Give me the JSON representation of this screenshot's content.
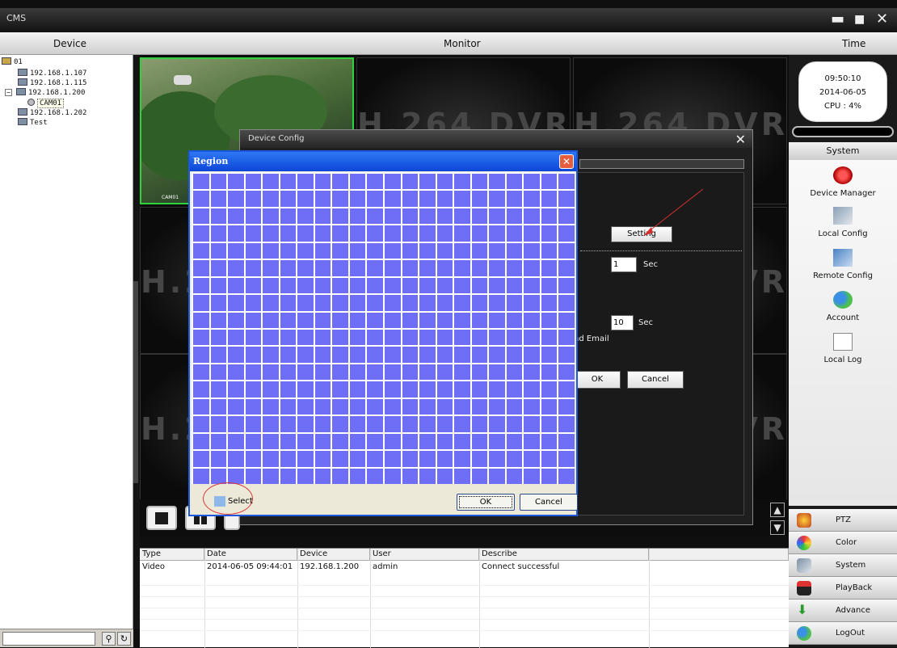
{
  "app": {
    "title": "CMS"
  },
  "header": {
    "device": "Device",
    "monitor": "Monitor",
    "time": "Time"
  },
  "tree": {
    "items": [
      "01",
      "192.168.1.107",
      "192.168.1.115",
      "192.168.1.200",
      "CAM01",
      "192.168.1.202",
      "Test"
    ]
  },
  "status": {
    "time": "09:50:10",
    "date": "2014-06-05",
    "cpu": "CPU : 4%"
  },
  "system_menu": {
    "header": "System",
    "items": [
      "Device Manager",
      "Local Config",
      "Remote Config",
      "Account",
      "Local Log"
    ]
  },
  "bottom_menu": [
    "PTZ",
    "Color",
    "System",
    "PlayBack",
    "Advance",
    "LogOut"
  ],
  "monitor": {
    "logo": "H.264 DVR",
    "ch1_label": "CAM01"
  },
  "log": {
    "columns": [
      "Type",
      "Date",
      "Device",
      "User",
      "Describe"
    ],
    "rows": [
      [
        "Video",
        "2014-06-05 09:44:01",
        "192.168.1.200",
        "admin",
        "Connect successful"
      ]
    ]
  },
  "device_config": {
    "title": "Device Config",
    "setting_label": "Setting",
    "interval1": "1",
    "sec1": "Sec",
    "interval2": "10",
    "sec2": "Sec",
    "email_fragment": "nd Email",
    "ok": "OK",
    "cancel": "Cancel"
  },
  "region": {
    "title": "Region",
    "select_label": "Select",
    "ok": "OK",
    "cancel": "Cancel"
  },
  "colors": {
    "grid": "#6e6ef7",
    "selection": "#2ed23a",
    "titlebar": "#1c58dd"
  }
}
